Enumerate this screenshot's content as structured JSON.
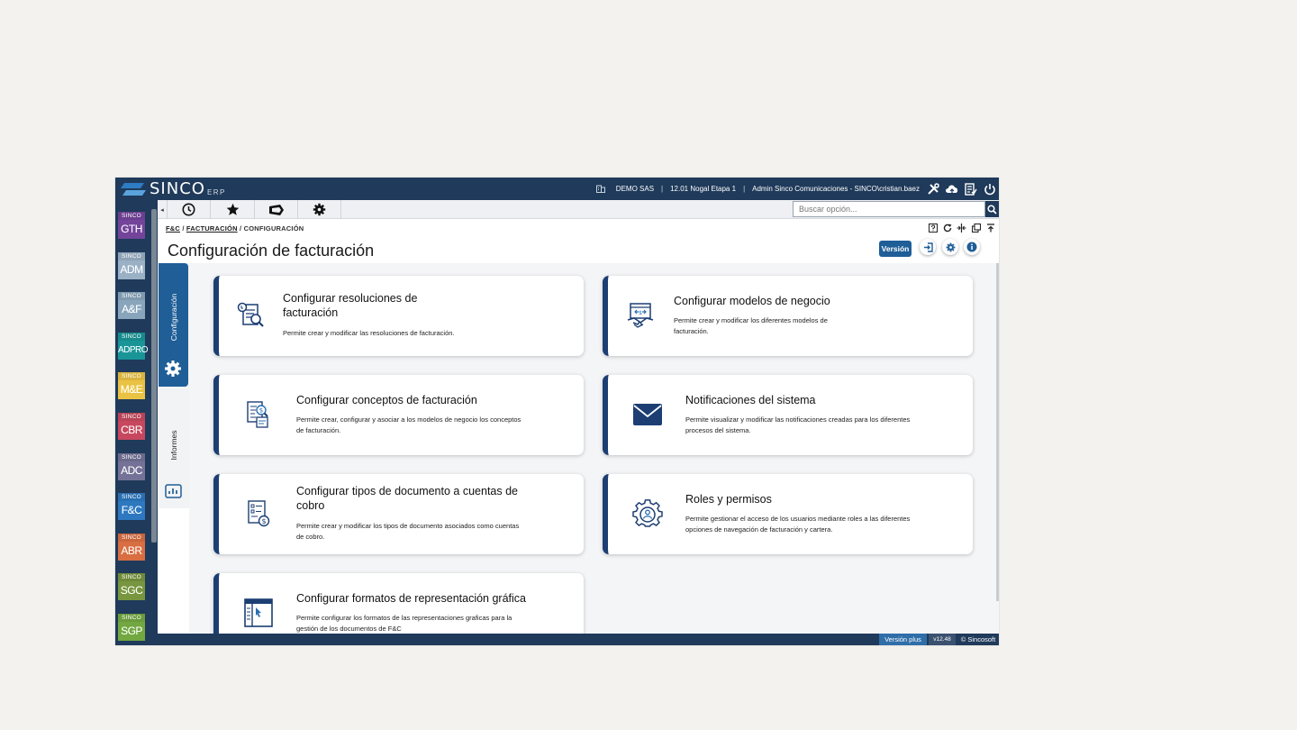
{
  "header": {
    "logo_text": "SINCO",
    "logo_sub": "ERP",
    "company": "DEMO SAS",
    "project": "12.01 Nogal Etapa 1",
    "user": "Admin Sinco Comunicaciones - SINCO\\cristian.baez",
    "separator": "|"
  },
  "modules": [
    {
      "tag": "SINCO",
      "code": "GTH",
      "color": "#6b3f8f"
    },
    {
      "tag": "SINCO",
      "code": "ADM",
      "color": "#8fa3b6"
    },
    {
      "tag": "SINCO",
      "code": "A&F",
      "color": "#7f99ae"
    },
    {
      "tag": "SINCO",
      "code": "ADPRO",
      "color": "#178a8c"
    },
    {
      "tag": "SINCO",
      "code": "M&E",
      "color": "#d9b43f"
    },
    {
      "tag": "SINCO",
      "code": "CBR",
      "color": "#b84357"
    },
    {
      "tag": "SINCO",
      "code": "ADC",
      "color": "#6c6a8c"
    },
    {
      "tag": "SINCO",
      "code": "F&C",
      "color": "#2a6fb1"
    },
    {
      "tag": "SINCO",
      "code": "ABR",
      "color": "#c8663d"
    },
    {
      "tag": "SINCO",
      "code": "SGC",
      "color": "#6f8a3a"
    },
    {
      "tag": "SINCO",
      "code": "SGP",
      "color": "#6a9b3c"
    }
  ],
  "search": {
    "placeholder": "Buscar opción..."
  },
  "breadcrumb": {
    "l1": "F&C",
    "l2": "FACTURACIÓN",
    "l3": "CONFIGURACIÓN",
    "sep": "/"
  },
  "page": {
    "title": "Configuración de facturación",
    "version_button": "Versión"
  },
  "sidetabs": {
    "config": "Configuración",
    "informes": "Informes"
  },
  "cards": [
    {
      "title_1": "Configurar resoluciones de",
      "title_2": "facturación",
      "desc_1": "Permite crear y modificar las resoluciones de facturación.",
      "desc_2": ""
    },
    {
      "title_1": "Configurar modelos de negocio",
      "title_2": "",
      "desc_1": "Permite crear y modificar los diferentes modelos de",
      "desc_2": "facturación."
    },
    {
      "title_1": "Configurar conceptos de facturación",
      "title_2": "",
      "desc_1": "Permite crear, configurar y asociar a los modelos de negocio los conceptos",
      "desc_2": "de facturación."
    },
    {
      "title_1": "Notificaciones del sistema",
      "title_2": "",
      "desc_1": "Permite visualizar y modificar las notificaciones creadas para los diferentes",
      "desc_2": "procesos del sistema."
    },
    {
      "title_1": "Configurar tipos de documento a cuentas de",
      "title_2": "cobro",
      "desc_1": "Permite crear y modificar los tipos de documento asociados como cuentas",
      "desc_2": "de cobro."
    },
    {
      "title_1": "Roles y permisos",
      "title_2": "",
      "desc_1": "Permite gestionar el acceso de los usuarios mediante roles a las diferentes",
      "desc_2": "opciones de navegación de facturación y cartera."
    },
    {
      "title_1": "Configurar formatos de representación gráfica",
      "title_2": "",
      "desc_1": "Permite configurar los formatos de las representaciones graficas para la",
      "desc_2": "gestión de los documentos de F&C"
    }
  ],
  "statusbar": {
    "plan": "Versión plus",
    "version": "v12.48",
    "copyright": "© Sincosoft"
  },
  "colors": {
    "navy": "#1f3a5a",
    "accent": "#1f5e97",
    "card_border": "#1c3e73",
    "icon": "#1c3e73"
  }
}
